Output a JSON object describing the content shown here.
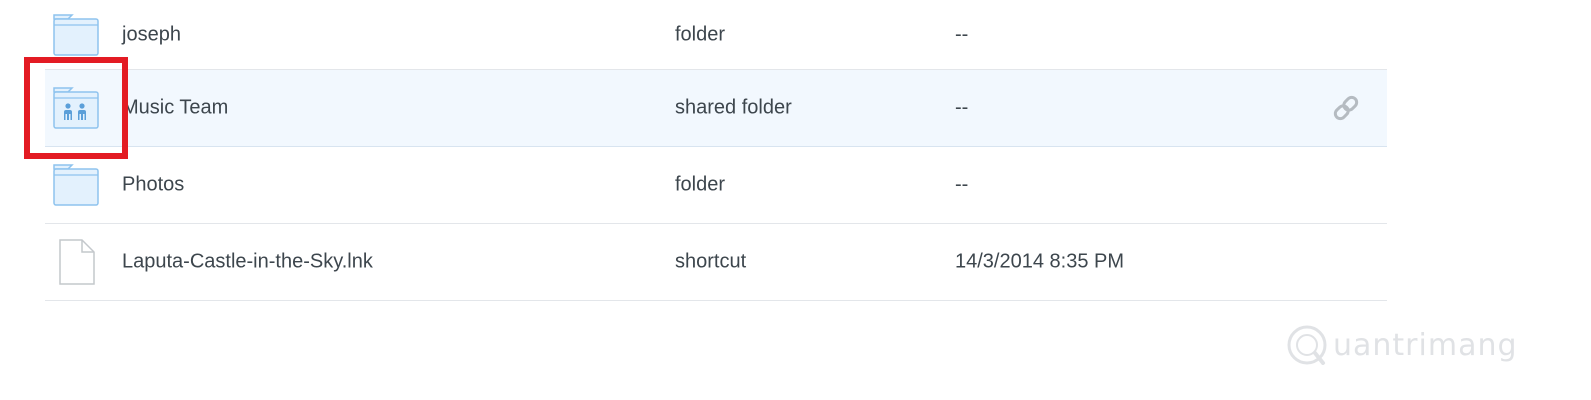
{
  "files": [
    {
      "name": "joseph",
      "kind": "folder",
      "modified": "--",
      "icon": "folder-icon"
    },
    {
      "name": "Music Team",
      "kind": "shared folder",
      "modified": "--",
      "icon": "shared-folder-icon",
      "selected": true
    },
    {
      "name": "Photos",
      "kind": "folder",
      "modified": "--",
      "icon": "folder-icon"
    },
    {
      "name": "Laputa-Castle-in-the-Sky.lnk",
      "kind": "shortcut",
      "modified": "14/3/2014 8:35 PM",
      "icon": "file-icon"
    }
  ],
  "row_actions": {
    "shared_link_icon": "link-icon"
  },
  "annotation": {
    "highlight_color": "#e31b23"
  },
  "watermark": {
    "text": "uantrimang"
  },
  "colors": {
    "text": "#3d464d",
    "folder_fill": "#e3f1fd",
    "folder_stroke": "#8ec3ee",
    "selected_row": "#f2f8fe",
    "divider": "#e3e6ea"
  }
}
